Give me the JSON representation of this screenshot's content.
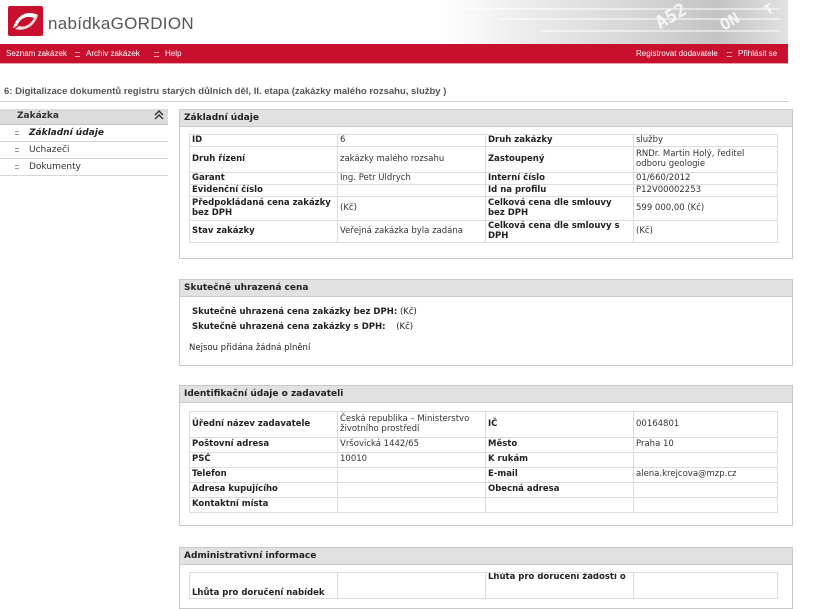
{
  "header": {
    "brand": "nabídkaGORDION",
    "art_text": [
      "A52",
      "ON",
      "T"
    ]
  },
  "nav": {
    "left": [
      "Seznam zakázek",
      "Archiv zakázek",
      "Help"
    ],
    "right": [
      "Registrovat dodavatele",
      "Přihlásit se"
    ]
  },
  "page_title": "6: Digitalizace dokumentů registru starých důlních děl, II. etapa (zakázky malého rozsahu, služby )",
  "sidebar": {
    "heading": "Zakázka",
    "collapse_glyph": "⌃",
    "items": [
      "Základní údaje",
      "Uchazeči",
      "Dokumenty"
    ]
  },
  "basic": {
    "heading": "Základní údaje",
    "rows": [
      [
        "ID",
        "6",
        "Druh zakázky",
        "služby"
      ],
      [
        "Druh řízení",
        "zakázky malého rozsahu",
        "Zastoupený",
        "RNDr. Martin Holý, ředitel odboru geologie"
      ],
      [
        "Garant",
        "Ing. Petr Uldrych",
        "Interní číslo",
        "01/660/2012"
      ],
      [
        "Evidenční číslo",
        "",
        "Id na profilu",
        "P12V00002253"
      ],
      [
        "Předpokládaná cena zakázky bez DPH",
        "(Kč)",
        "Celková cena dle smlouvy bez DPH",
        "599 000,00 (Kč)"
      ],
      [
        "Stav zakázky",
        "Veřejná zakázka byla zadána",
        "Celková cena dle smlouvy s DPH",
        "(Kč)"
      ]
    ]
  },
  "paid": {
    "heading": "Skutečně uhrazená cena",
    "without_vat_label": "Skutečně uhrazená cena zakázky bez DPH:",
    "without_vat_value": "(Kč)",
    "with_vat_label": "Skutečně uhrazená cena zakázky s DPH:",
    "with_vat_value": "(Kč)",
    "note": "Nejsou přidána žádná plnění"
  },
  "contracting": {
    "heading": "Identifikační údaje o zadavateli",
    "rows": [
      [
        "Úřední název zadavatele",
        "Česká republika – Ministerstvo životního prostředí",
        "IČ",
        "00164801"
      ],
      [
        "Poštovní adresa",
        "Vršovická 1442/65",
        "Město",
        "Praha 10"
      ],
      [
        "PSČ",
        "10010",
        "K rukám",
        ""
      ],
      [
        "Telefon",
        "",
        "E-mail",
        "alena.krejcova@mzp.cz"
      ],
      [
        "Adresa kupujícího",
        "",
        "Obecná adresa",
        ""
      ],
      [
        "Kontaktní místa",
        "",
        "",
        ""
      ]
    ]
  },
  "admin": {
    "heading": "Administrativní informace",
    "row0_left": "Lhůta pro doručení nabídek",
    "row0_right": "Lhůta pro doručení žádostí o"
  }
}
